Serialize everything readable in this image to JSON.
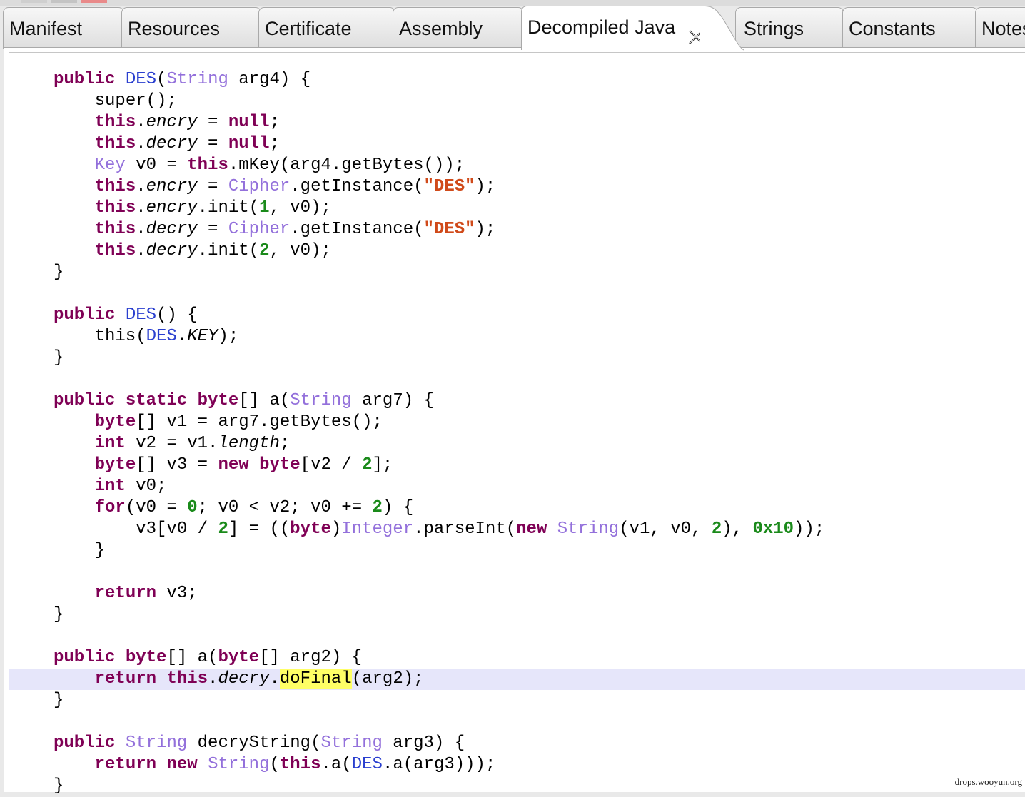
{
  "tabs": [
    {
      "label": "Manifest"
    },
    {
      "label": "Resources"
    },
    {
      "label": "Certificate"
    },
    {
      "label": "Assembly"
    },
    {
      "label": "Decompiled Java",
      "active": true
    },
    {
      "label": "Strings"
    },
    {
      "label": "Constants"
    },
    {
      "label": "Notes"
    }
  ],
  "colors": {
    "keyword": "#7f0055",
    "type": "#9370db",
    "class": "#2a3fcf",
    "string": "#d04a1a",
    "number": "#1a8a1a",
    "current_line": "#e6e6fa",
    "highlight": "#ffff66"
  },
  "code": {
    "highlight_line_index": 28,
    "lines": [
      [
        {
          "t": "public",
          "c": "kw"
        },
        {
          "t": " "
        },
        {
          "t": "DES",
          "c": "cl"
        },
        {
          "t": "("
        },
        {
          "t": "String",
          "c": "ty"
        },
        {
          "t": " arg4) {"
        }
      ],
      [
        {
          "t": "    super();"
        }
      ],
      [
        {
          "t": "    "
        },
        {
          "t": "this",
          "c": "kw"
        },
        {
          "t": "."
        },
        {
          "t": "encry",
          "c": "fld"
        },
        {
          "t": " = "
        },
        {
          "t": "null",
          "c": "kw"
        },
        {
          "t": ";"
        }
      ],
      [
        {
          "t": "    "
        },
        {
          "t": "this",
          "c": "kw"
        },
        {
          "t": "."
        },
        {
          "t": "decry",
          "c": "fld"
        },
        {
          "t": " = "
        },
        {
          "t": "null",
          "c": "kw"
        },
        {
          "t": ";"
        }
      ],
      [
        {
          "t": "    "
        },
        {
          "t": "Key",
          "c": "ty"
        },
        {
          "t": " v0 = "
        },
        {
          "t": "this",
          "c": "kw"
        },
        {
          "t": ".mKey(arg4.getBytes());"
        }
      ],
      [
        {
          "t": "    "
        },
        {
          "t": "this",
          "c": "kw"
        },
        {
          "t": "."
        },
        {
          "t": "encry",
          "c": "fld"
        },
        {
          "t": " = "
        },
        {
          "t": "Cipher",
          "c": "ty"
        },
        {
          "t": ".getInstance("
        },
        {
          "t": "\"DES\"",
          "c": "str"
        },
        {
          "t": ");"
        }
      ],
      [
        {
          "t": "    "
        },
        {
          "t": "this",
          "c": "kw"
        },
        {
          "t": "."
        },
        {
          "t": "encry",
          "c": "fld"
        },
        {
          "t": ".init("
        },
        {
          "t": "1",
          "c": "num"
        },
        {
          "t": ", v0);"
        }
      ],
      [
        {
          "t": "    "
        },
        {
          "t": "this",
          "c": "kw"
        },
        {
          "t": "."
        },
        {
          "t": "decry",
          "c": "fld"
        },
        {
          "t": " = "
        },
        {
          "t": "Cipher",
          "c": "ty"
        },
        {
          "t": ".getInstance("
        },
        {
          "t": "\"DES\"",
          "c": "str"
        },
        {
          "t": ");"
        }
      ],
      [
        {
          "t": "    "
        },
        {
          "t": "this",
          "c": "kw"
        },
        {
          "t": "."
        },
        {
          "t": "decry",
          "c": "fld"
        },
        {
          "t": ".init("
        },
        {
          "t": "2",
          "c": "num"
        },
        {
          "t": ", v0);"
        }
      ],
      [
        {
          "t": "}"
        }
      ],
      [],
      [
        {
          "t": "public",
          "c": "kw"
        },
        {
          "t": " "
        },
        {
          "t": "DES",
          "c": "cl"
        },
        {
          "t": "() {"
        }
      ],
      [
        {
          "t": "    this("
        },
        {
          "t": "DES",
          "c": "cl"
        },
        {
          "t": "."
        },
        {
          "t": "KEY",
          "c": "fld"
        },
        {
          "t": ");"
        }
      ],
      [
        {
          "t": "}"
        }
      ],
      [],
      [
        {
          "t": "public",
          "c": "kw"
        },
        {
          "t": " "
        },
        {
          "t": "static",
          "c": "kw"
        },
        {
          "t": " "
        },
        {
          "t": "byte",
          "c": "kw"
        },
        {
          "t": "[] a("
        },
        {
          "t": "String",
          "c": "ty"
        },
        {
          "t": " arg7) {"
        }
      ],
      [
        {
          "t": "    "
        },
        {
          "t": "byte",
          "c": "kw"
        },
        {
          "t": "[] v1 = arg7.getBytes();"
        }
      ],
      [
        {
          "t": "    "
        },
        {
          "t": "int",
          "c": "kw"
        },
        {
          "t": " v2 = v1."
        },
        {
          "t": "length",
          "c": "fld"
        },
        {
          "t": ";"
        }
      ],
      [
        {
          "t": "    "
        },
        {
          "t": "byte",
          "c": "kw"
        },
        {
          "t": "[] v3 = "
        },
        {
          "t": "new",
          "c": "kw"
        },
        {
          "t": " "
        },
        {
          "t": "byte",
          "c": "kw"
        },
        {
          "t": "[v2 / "
        },
        {
          "t": "2",
          "c": "num"
        },
        {
          "t": "];"
        }
      ],
      [
        {
          "t": "    "
        },
        {
          "t": "int",
          "c": "kw"
        },
        {
          "t": " v0;"
        }
      ],
      [
        {
          "t": "    "
        },
        {
          "t": "for",
          "c": "kw"
        },
        {
          "t": "(v0 = "
        },
        {
          "t": "0",
          "c": "num"
        },
        {
          "t": "; v0 < v2; v0 += "
        },
        {
          "t": "2",
          "c": "num"
        },
        {
          "t": ") {"
        }
      ],
      [
        {
          "t": "        v3[v0 / "
        },
        {
          "t": "2",
          "c": "num"
        },
        {
          "t": "] = (("
        },
        {
          "t": "byte",
          "c": "kw"
        },
        {
          "t": ")"
        },
        {
          "t": "Integer",
          "c": "ty"
        },
        {
          "t": ".parseInt("
        },
        {
          "t": "new",
          "c": "kw"
        },
        {
          "t": " "
        },
        {
          "t": "String",
          "c": "ty"
        },
        {
          "t": "(v1, v0, "
        },
        {
          "t": "2",
          "c": "num"
        },
        {
          "t": "), "
        },
        {
          "t": "0x10",
          "c": "num"
        },
        {
          "t": "));"
        }
      ],
      [
        {
          "t": "    }"
        }
      ],
      [],
      [
        {
          "t": "    "
        },
        {
          "t": "return",
          "c": "kw"
        },
        {
          "t": " v3;"
        }
      ],
      [
        {
          "t": "}"
        }
      ],
      [],
      [
        {
          "t": "public",
          "c": "kw"
        },
        {
          "t": " "
        },
        {
          "t": "byte",
          "c": "kw"
        },
        {
          "t": "[] a("
        },
        {
          "t": "byte",
          "c": "kw"
        },
        {
          "t": "[] arg2) {"
        }
      ],
      [
        {
          "t": "    "
        },
        {
          "t": "return",
          "c": "kw"
        },
        {
          "t": " "
        },
        {
          "t": "this",
          "c": "kw"
        },
        {
          "t": "."
        },
        {
          "t": "decry",
          "c": "fld"
        },
        {
          "t": "."
        },
        {
          "t": "doFinal",
          "c": "hl"
        },
        {
          "t": "(arg2);"
        }
      ],
      [
        {
          "t": "}"
        }
      ],
      [],
      [
        {
          "t": "public",
          "c": "kw"
        },
        {
          "t": " "
        },
        {
          "t": "String",
          "c": "ty"
        },
        {
          "t": " decryString("
        },
        {
          "t": "String",
          "c": "ty"
        },
        {
          "t": " arg3) {"
        }
      ],
      [
        {
          "t": "    "
        },
        {
          "t": "return",
          "c": "kw"
        },
        {
          "t": " "
        },
        {
          "t": "new",
          "c": "kw"
        },
        {
          "t": " "
        },
        {
          "t": "String",
          "c": "ty"
        },
        {
          "t": "("
        },
        {
          "t": "this",
          "c": "kw"
        },
        {
          "t": ".a("
        },
        {
          "t": "DES",
          "c": "cl"
        },
        {
          "t": ".a(arg3)));"
        }
      ],
      [
        {
          "t": "}"
        }
      ]
    ]
  },
  "watermark": "drops.wooyun.org"
}
